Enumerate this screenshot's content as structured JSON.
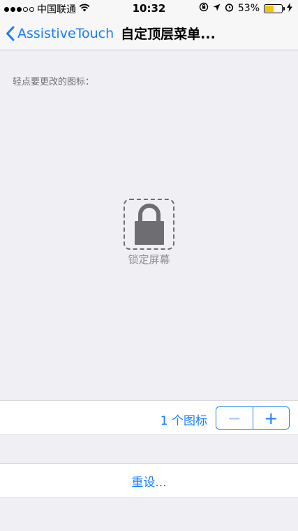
{
  "status_bar": {
    "carrier": "中国联通",
    "time": "10:32",
    "battery_percent": "53%",
    "battery_level": 0.53,
    "battery_color": "#f5c400"
  },
  "nav": {
    "back_label": "AssistiveTouch",
    "title": "自定顶层菜单..."
  },
  "hint": "轻点要更改的图标：",
  "icon": {
    "name": "lock-icon",
    "label": "锁定屏幕"
  },
  "count": {
    "text": "1 个图标",
    "minus_label": "−",
    "plus_label": "+"
  },
  "reset_label": "重设...",
  "colors": {
    "accent": "#157efb",
    "background": "#efeff4"
  }
}
